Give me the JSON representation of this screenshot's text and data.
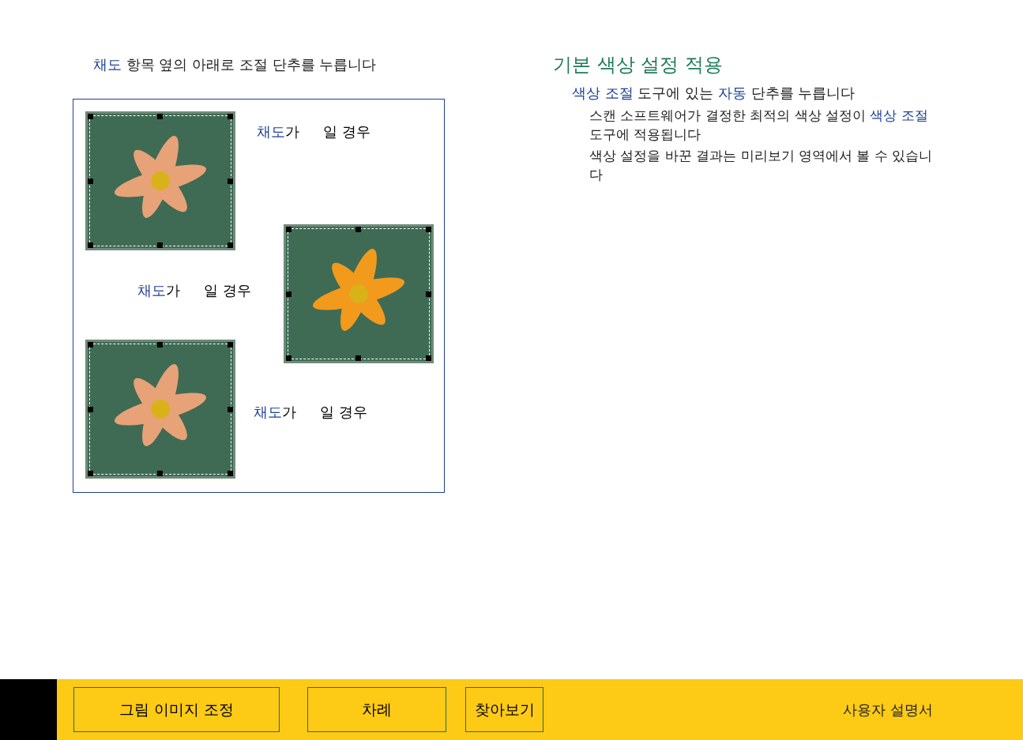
{
  "step": [
    {
      "text": "채도",
      "kind": "term"
    },
    {
      "text": " 항목 옆의 아래로 조절 단추를 누릅니다",
      "kind": "plain"
    }
  ],
  "figure": [
    {
      "caption": [
        {
          "text": "채도",
          "kind": "term"
        },
        {
          "text": "가",
          "kind": "plain"
        }
      ],
      "caption_tail": "일 경우"
    },
    {
      "caption": [
        {
          "text": "채도",
          "kind": "term"
        },
        {
          "text": "가",
          "kind": "plain"
        }
      ],
      "caption_tail": "일 경우"
    },
    {
      "caption": [
        {
          "text": "채도",
          "kind": "term"
        },
        {
          "text": "가",
          "kind": "plain"
        }
      ],
      "caption_tail": "일 경우"
    }
  ],
  "section": {
    "heading": "기본 색상 설정 적용",
    "instruction": [
      {
        "text": "색상 조절",
        "kind": "term"
      },
      {
        "text": " 도구에 있는 ",
        "kind": "plain"
      },
      {
        "text": "자동",
        "kind": "term"
      },
      {
        "text": " 단추를 누릅니다",
        "kind": "plain"
      }
    ],
    "notes": [
      [
        {
          "text": "스캔 소프트웨어가 결정한 최적의 색상 설정이 ",
          "kind": "plain"
        },
        {
          "text": "색상 조절",
          "kind": "term"
        },
        {
          "text": " 도구에 적용됩니다",
          "kind": "plain"
        }
      ],
      [
        {
          "text": "색상 설정을 바꾼 결과는 미리보기 영역에서 볼 수 있습니다",
          "kind": "plain"
        }
      ]
    ]
  },
  "nav": {
    "buttons": [
      {
        "label": "그림 이미지 조정"
      },
      {
        "label": "차례"
      },
      {
        "label": "찾아보기"
      }
    ],
    "title": "사용자 설명서"
  }
}
